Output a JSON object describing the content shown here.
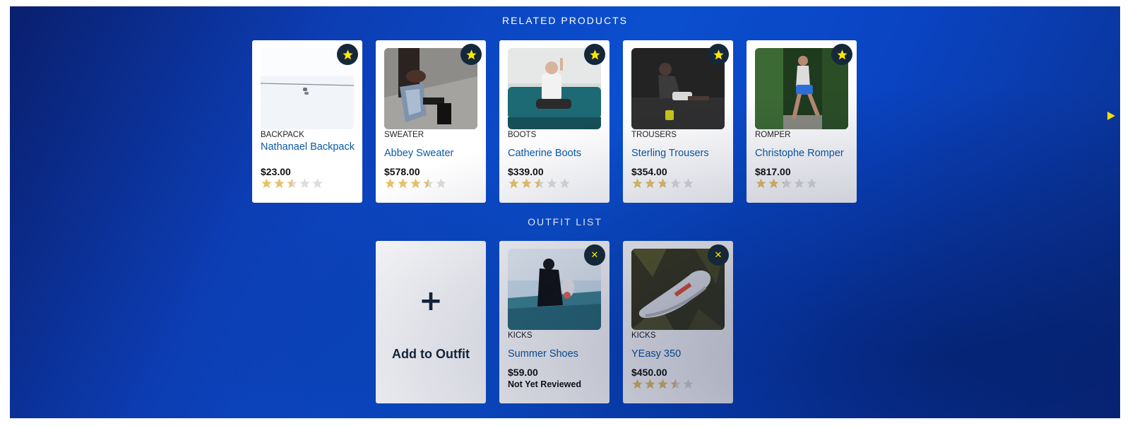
{
  "related": {
    "title": "RELATED PRODUCTS",
    "products": [
      {
        "category": "BACKPACK",
        "name": "Nathanael Backpack",
        "price": "$23.00",
        "rating": 2.5,
        "favorite_icon": "star-icon"
      },
      {
        "category": "SWEATER",
        "name": "Abbey Sweater",
        "price": "$578.00",
        "rating": 3.5,
        "favorite_icon": "star-icon"
      },
      {
        "category": "BOOTS",
        "name": "Catherine Boots",
        "price": "$339.00",
        "rating": 2.5,
        "favorite_icon": "star-icon"
      },
      {
        "category": "TROUSERS",
        "name": "Sterling Trousers",
        "price": "$354.00",
        "rating": 2.75,
        "favorite_icon": "star-icon"
      },
      {
        "category": "ROMPER",
        "name": "Christophe Romper",
        "price": "$817.00",
        "rating": 2.25,
        "favorite_icon": "star-icon"
      }
    ],
    "next_icon": "triangle-right-icon"
  },
  "outfit": {
    "title": "OUTFIT LIST",
    "add_card": {
      "plus": "+",
      "label": "Add to Outfit"
    },
    "items": [
      {
        "category": "KICKS",
        "name": "Summer Shoes",
        "price": "$59.00",
        "review_text": "Not Yet Reviewed",
        "remove_icon": "close-icon",
        "remove_symbol": "✕"
      },
      {
        "category": "KICKS",
        "name": "YEasy 350",
        "price": "$450.00",
        "rating": 3.5,
        "remove_icon": "close-icon",
        "remove_symbol": "✕"
      }
    ]
  },
  "colors": {
    "accent_star": "#ffe600",
    "rating_fill": "#e6c36a",
    "rating_empty": "#dddddd",
    "link": "#0a5aa8",
    "badge_bg": "#15283a"
  }
}
